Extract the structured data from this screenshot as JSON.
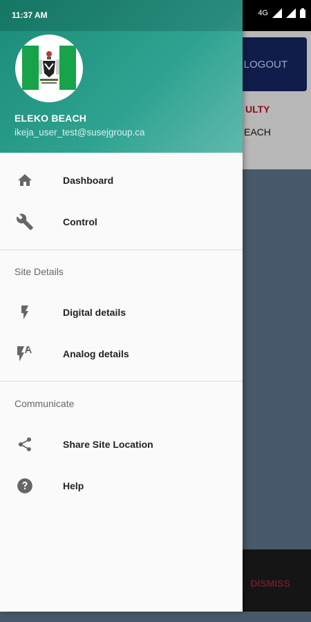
{
  "status_bar": {
    "time": "11:37 AM",
    "network": "4G"
  },
  "background_app": {
    "logout_label": "LOGOUT",
    "fault_text": "ULTY",
    "site_text": "EACH",
    "dismiss_label": "DISMISS"
  },
  "drawer": {
    "header": {
      "site_name": "ELEKO BEACH",
      "email": "ikeja_user_test@susejgroup.ca",
      "avatar_label": "Nigeria coat of arms logo"
    },
    "menu": [
      {
        "label": "Dashboard",
        "icon": "home-icon"
      },
      {
        "label": "Control",
        "icon": "wrench-icon"
      }
    ],
    "sections": [
      {
        "title": "Site Details",
        "items": [
          {
            "label": "Digital details",
            "icon": "flash-icon"
          },
          {
            "label": "Analog details",
            "icon": "flash-auto-icon"
          }
        ]
      },
      {
        "title": "Communicate",
        "items": [
          {
            "label": "Share Site Location",
            "icon": "share-icon"
          },
          {
            "label": "Help",
            "icon": "help-icon"
          }
        ]
      }
    ],
    "colors": {
      "header_start": "#1a8b76",
      "header_end": "#5fb9ad",
      "icon": "#666666"
    }
  }
}
